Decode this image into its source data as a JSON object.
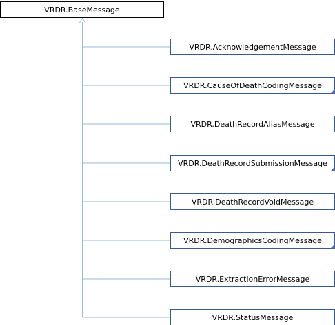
{
  "diagram": {
    "base_class": "VRDR.BaseMessage",
    "derived_classes": [
      {
        "label": "VRDR.AcknowledgementMessage",
        "has_corner_marker": false
      },
      {
        "label": "VRDR.CauseOfDeathCodingMessage",
        "has_corner_marker": true
      },
      {
        "label": "VRDR.DeathRecordAliasMessage",
        "has_corner_marker": false
      },
      {
        "label": "VRDR.DeathRecordSubmissionMessage",
        "has_corner_marker": true
      },
      {
        "label": "VRDR.DeathRecordVoidMessage",
        "has_corner_marker": false
      },
      {
        "label": "VRDR.DemographicsCodingMessage",
        "has_corner_marker": true
      },
      {
        "label": "VRDR.ExtractionErrorMessage",
        "has_corner_marker": false
      },
      {
        "label": "VRDR.StatusMessage",
        "has_corner_marker": false
      }
    ],
    "colors": {
      "base_border": "#000000",
      "base_fill": "#ffffff",
      "child_border": "#3b5a8c",
      "child_fill": "#ffffff",
      "connector": "#9ab9d8",
      "corner_marker": "#5474b0"
    }
  }
}
